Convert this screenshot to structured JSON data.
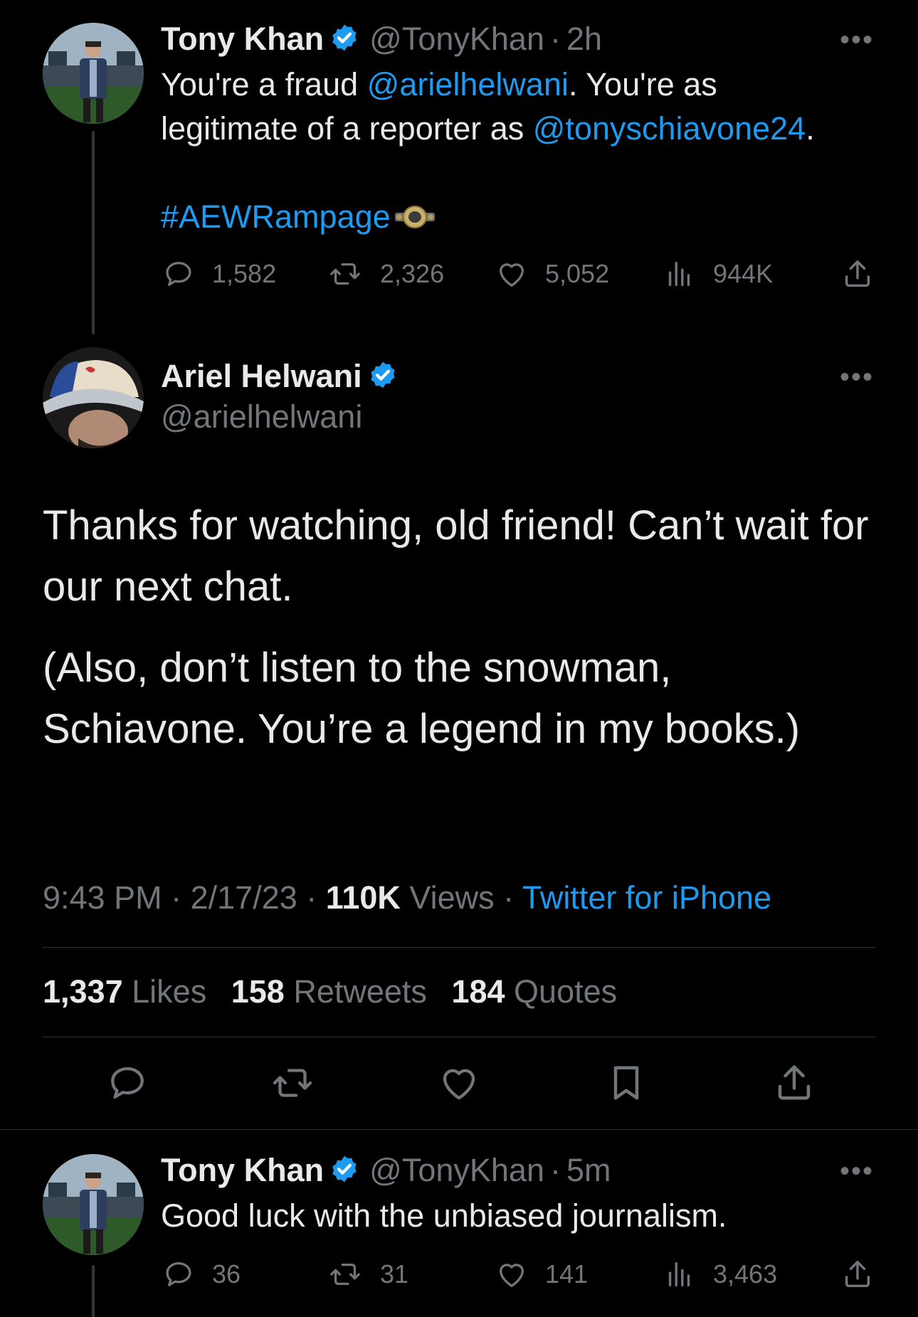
{
  "tweet1": {
    "name": "Tony Khan",
    "handle": "@TonyKhan",
    "sep": "·",
    "time": "2h",
    "more": "•••",
    "text_a": "You're a fraud ",
    "mention1": "@arielhelwani",
    "text_b": ". You're as",
    "text_c": "legitimate of a reporter as ",
    "mention2": "@tonyschiavone24",
    "text_d": ".",
    "hashtag": "#AEWRampage",
    "stats": {
      "replies": "1,582",
      "retweets": "2,326",
      "likes": "5,052",
      "views": "944K"
    }
  },
  "main": {
    "name": "Ariel Helwani",
    "handle": "@arielhelwani",
    "more": "•••",
    "para1": "Thanks for watching, old friend! Can’t wait for our next chat.",
    "para2": "(Also, don’t listen to the snowman, Schiavone. You’re a legend in my books.)",
    "time": "9:43 PM",
    "date": "2/17/23",
    "views_count": "110K",
    "views_label": "Views",
    "dot": "·",
    "source": "Twitter for iPhone",
    "likes_count": "1,337",
    "likes_label": "Likes",
    "retweets_count": "158",
    "retweets_label": "Retweets",
    "quotes_count": "184",
    "quotes_label": "Quotes"
  },
  "tweet3": {
    "name": "Tony Khan",
    "handle": "@TonyKhan",
    "sep": "·",
    "time": "5m",
    "more": "•••",
    "text": "Good luck with the unbiased journalism.",
    "stats": {
      "replies": "36",
      "retweets": "31",
      "likes": "141",
      "views": "3,463"
    }
  },
  "colors": {
    "accent": "#1d9bf0",
    "muted": "#71767b",
    "text": "#e7e9ea",
    "background": "#000000"
  }
}
